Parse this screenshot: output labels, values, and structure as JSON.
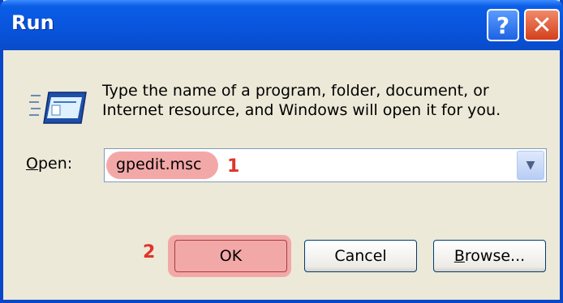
{
  "window": {
    "title": "Run",
    "help_glyph": "?",
    "close_glyph": "✕",
    "icons": {
      "app": "run-icon",
      "help": "help-icon",
      "close": "close-icon",
      "dropdown": "chevron-down-icon"
    },
    "colors": {
      "titlebar": "#0a56df",
      "highlight": "#f3a8a8",
      "marker": "#e0342a"
    }
  },
  "description": {
    "line1": "Type the name of a program, folder, document, or",
    "line2": "Internet resource, and Windows will open it for you."
  },
  "open": {
    "label_mnemonic": "O",
    "label_rest": "pen:",
    "value": "gpedit.msc",
    "arrow": "▼"
  },
  "steps": {
    "step1": "1",
    "step2": "2"
  },
  "buttons": {
    "ok": "OK",
    "cancel": "Cancel",
    "browse_mnemonic": "B",
    "browse_rest": "rowse..."
  }
}
